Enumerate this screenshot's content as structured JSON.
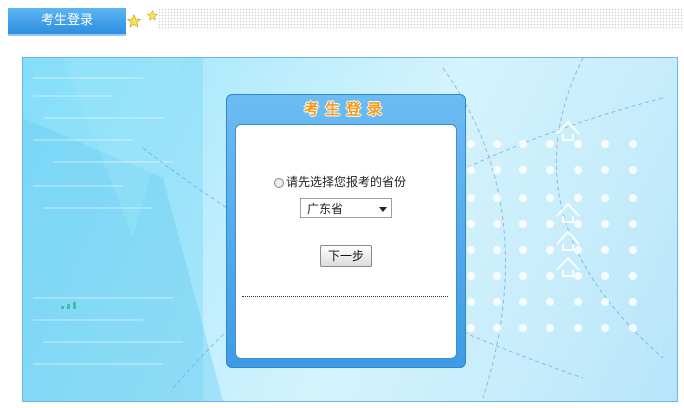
{
  "header": {
    "tab_label": "考生登录"
  },
  "login": {
    "title": "考生登录",
    "prompt": "请先选择您报考的省份",
    "selected_province": "广东省",
    "next_button": "下一步"
  },
  "colors": {
    "header_tab": "#3a9be8",
    "title_orange": "#f39a1b",
    "panel_border": "#6fb5e8"
  },
  "icons": [
    "star-icon",
    "radio-icon",
    "chevron-down-icon",
    "arrow-up-icon"
  ]
}
